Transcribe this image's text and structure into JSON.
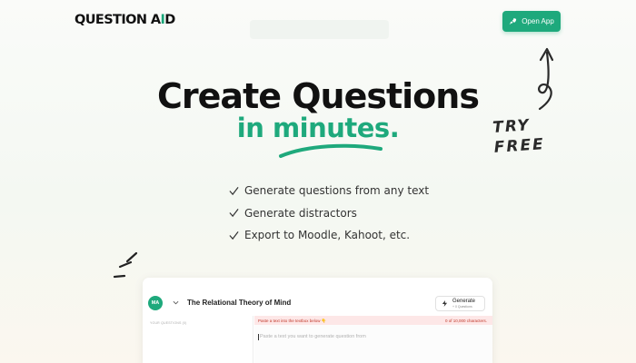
{
  "header": {
    "logo_prefix": "QUESTION A",
    "logo_accent": "I",
    "logo_suffix": "D",
    "cta_label": "Open App"
  },
  "hero": {
    "title_line1": "Create Questions",
    "title_line2": "in minutes.",
    "try_line1": "TRY",
    "try_line2": "FREE"
  },
  "features": [
    "Generate questions from any text",
    "Generate distractors",
    "Export to Moodle, Kahoot, etc."
  ],
  "app_preview": {
    "avatar": "MA",
    "doc_title": "The Relational Theory of Mind",
    "generate_label": "Generate",
    "generate_sub": "+ 0 Questions",
    "sidebar_label": "YOUR QUESTIONS (0)",
    "notice": "Paste a text into the textbox below 👇",
    "char_count": "0 of 10,000 characters.",
    "textarea_placeholder": "Paste a text you want to generate question from"
  },
  "colors": {
    "brand": "#1ea97c",
    "text": "#111111",
    "notice_bg": "#fde7e7"
  }
}
